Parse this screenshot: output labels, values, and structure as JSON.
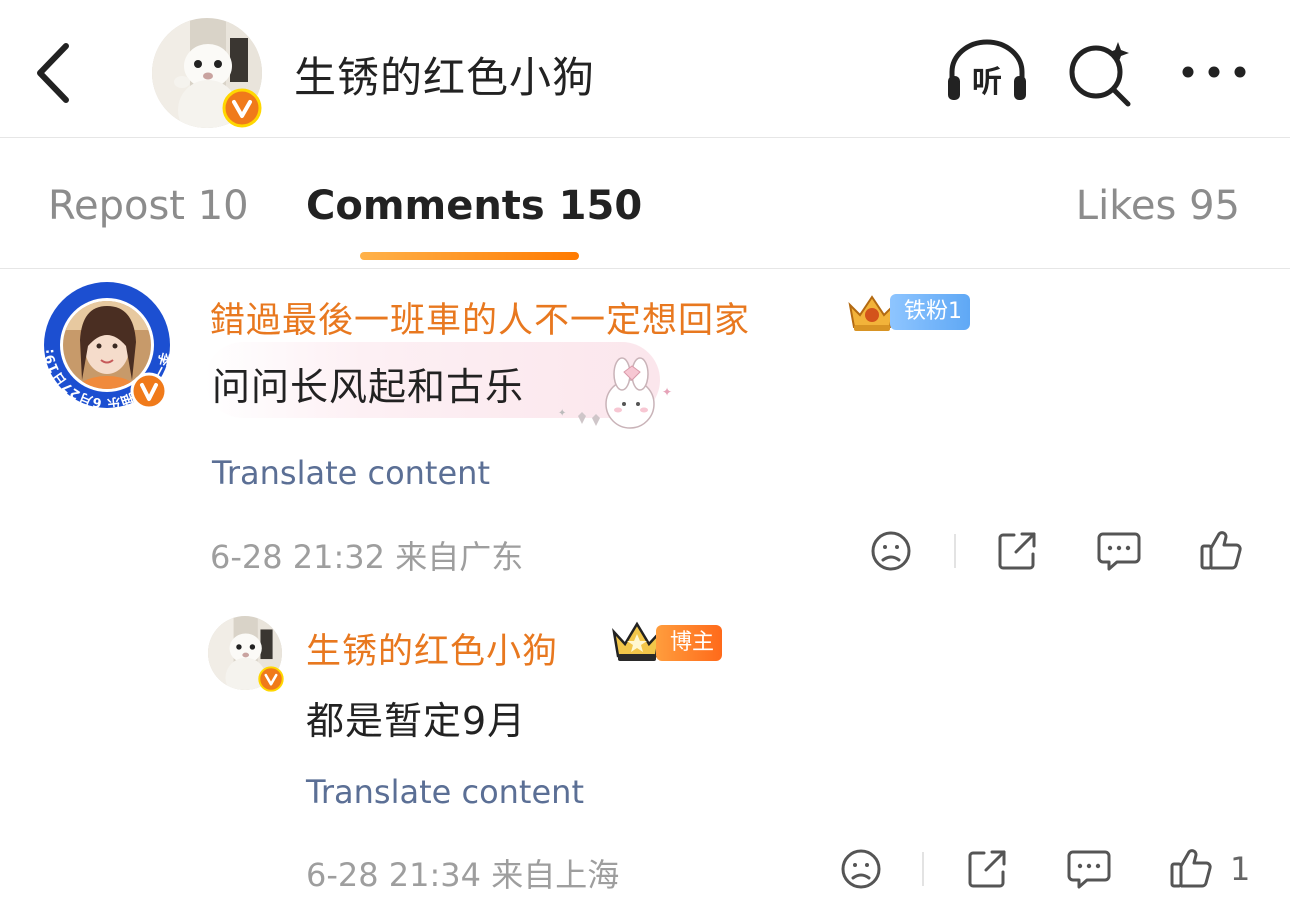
{
  "header": {
    "title": "生锈的红色小狗",
    "listen_label": "听"
  },
  "tabs": {
    "repost": "Repost 10",
    "comments": "Comments 150",
    "likes": "Likes 95"
  },
  "colors": {
    "accent": "#ff7a00",
    "username": "#e8781f",
    "link": "#5b6f95",
    "verified": "#f07a1a"
  },
  "comments": [
    {
      "username": "錯過最後一班車的人不一定想回家",
      "badge": "铁粉1",
      "text": "问问长风起和古乐",
      "avatar_ring_text": "李一桐抽抽乐 6月27日19:06起 指路",
      "translate": "Translate content",
      "time": "6-28 21:32",
      "location": "来自广东"
    },
    {
      "username": "生锈的红色小狗",
      "badge": "博主",
      "text": "都是暂定9月",
      "translate": "Translate content",
      "time": "6-28 21:34",
      "location": "来自上海",
      "likes": "1"
    }
  ],
  "icons": [
    "back-icon",
    "listen-icon",
    "search-sparkle-icon",
    "more-icon",
    "dislike-face-icon",
    "share-icon",
    "comment-icon",
    "thumbs-up-icon",
    "verified-icon",
    "crown-icon"
  ]
}
